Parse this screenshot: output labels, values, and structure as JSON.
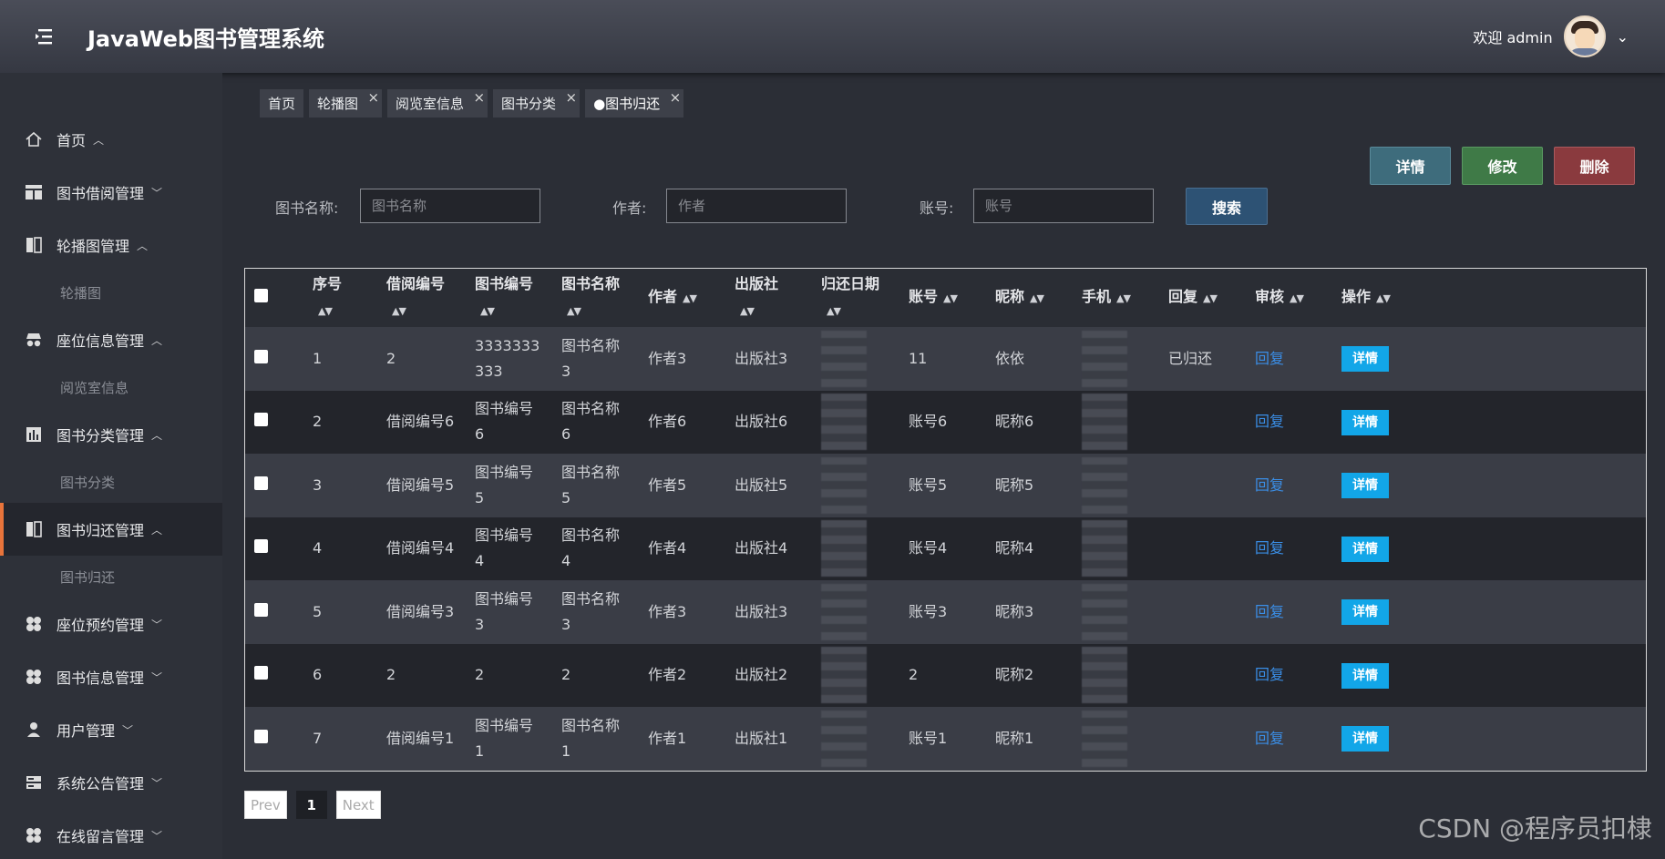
{
  "header": {
    "title": "JavaWeb图书管理系统",
    "welcome": "欢迎 admin"
  },
  "sidebar": {
    "items": [
      {
        "label": "首页",
        "icon": "home-icon",
        "arrow": "^"
      },
      {
        "label": "图书借阅管理",
        "icon": "layout-icon",
        "arrow": "v"
      },
      {
        "label": "轮播图管理",
        "icon": "columns-icon",
        "arrow": "^",
        "sub": "轮播图"
      },
      {
        "label": "座位信息管理",
        "icon": "spy-icon",
        "arrow": "^",
        "sub": "阅览室信息"
      },
      {
        "label": "图书分类管理",
        "icon": "chart-icon",
        "arrow": "^",
        "sub": "图书分类"
      },
      {
        "label": "图书归还管理",
        "icon": "columns-icon",
        "arrow": "^",
        "sub": "图书归还"
      },
      {
        "label": "座位预约管理",
        "icon": "grid-icon",
        "arrow": "v"
      },
      {
        "label": "图书信息管理",
        "icon": "grid-icon",
        "arrow": "v"
      },
      {
        "label": "用户管理",
        "icon": "user-icon",
        "arrow": "v"
      },
      {
        "label": "系统公告管理",
        "icon": "server-icon",
        "arrow": "v"
      },
      {
        "label": "在线留言管理",
        "icon": "grid-icon",
        "arrow": "v"
      }
    ]
  },
  "tags": [
    "首页",
    "轮播图",
    "阅览室信息",
    "图书分类",
    "●图书归还"
  ],
  "actions": {
    "detail": "详情",
    "edit": "修改",
    "delete": "删除"
  },
  "search": {
    "book_name_label": "图书名称:",
    "book_name_placeholder": "图书名称",
    "author_label": "作者:",
    "author_placeholder": "作者",
    "account_label": "账号:",
    "account_placeholder": "账号",
    "button": "搜索"
  },
  "table": {
    "headers": [
      "序号",
      "借阅编号",
      "图书编号",
      "图书名称",
      "作者",
      "出版社",
      "归还日期",
      "账号",
      "昵称",
      "手机",
      "回复",
      "审核",
      "操作"
    ],
    "reply_label": "回复",
    "detail_label": "详情",
    "rows": [
      {
        "no": "1",
        "borrow_no": "2",
        "book_no": "3333333 333",
        "book_name": "图书名称 3",
        "author": "作者3",
        "publisher": "出版社3",
        "account": "11",
        "nickname": "依依",
        "reply": "已归还"
      },
      {
        "no": "2",
        "borrow_no": "借阅编号6",
        "book_no": "图书编号 6",
        "book_name": "图书名称 6",
        "author": "作者6",
        "publisher": "出版社6",
        "account": "账号6",
        "nickname": "昵称6",
        "reply": ""
      },
      {
        "no": "3",
        "borrow_no": "借阅编号5",
        "book_no": "图书编号 5",
        "book_name": "图书名称 5",
        "author": "作者5",
        "publisher": "出版社5",
        "account": "账号5",
        "nickname": "昵称5",
        "reply": ""
      },
      {
        "no": "4",
        "borrow_no": "借阅编号4",
        "book_no": "图书编号 4",
        "book_name": "图书名称 4",
        "author": "作者4",
        "publisher": "出版社4",
        "account": "账号4",
        "nickname": "昵称4",
        "reply": ""
      },
      {
        "no": "5",
        "borrow_no": "借阅编号3",
        "book_no": "图书编号 3",
        "book_name": "图书名称 3",
        "author": "作者3",
        "publisher": "出版社3",
        "account": "账号3",
        "nickname": "昵称3",
        "reply": ""
      },
      {
        "no": "6",
        "borrow_no": "2",
        "book_no": "2",
        "book_name": "2",
        "author": "作者2",
        "publisher": "出版社2",
        "account": "2",
        "nickname": "昵称2",
        "reply": ""
      },
      {
        "no": "7",
        "borrow_no": "借阅编号1",
        "book_no": "图书编号 1",
        "book_name": "图书名称 1",
        "author": "作者1",
        "publisher": "出版社1",
        "account": "账号1",
        "nickname": "昵称1",
        "reply": ""
      }
    ]
  },
  "pager": {
    "prev": "Prev",
    "page": "1",
    "next": "Next"
  },
  "watermark": "CSDN @程序员扣棣"
}
